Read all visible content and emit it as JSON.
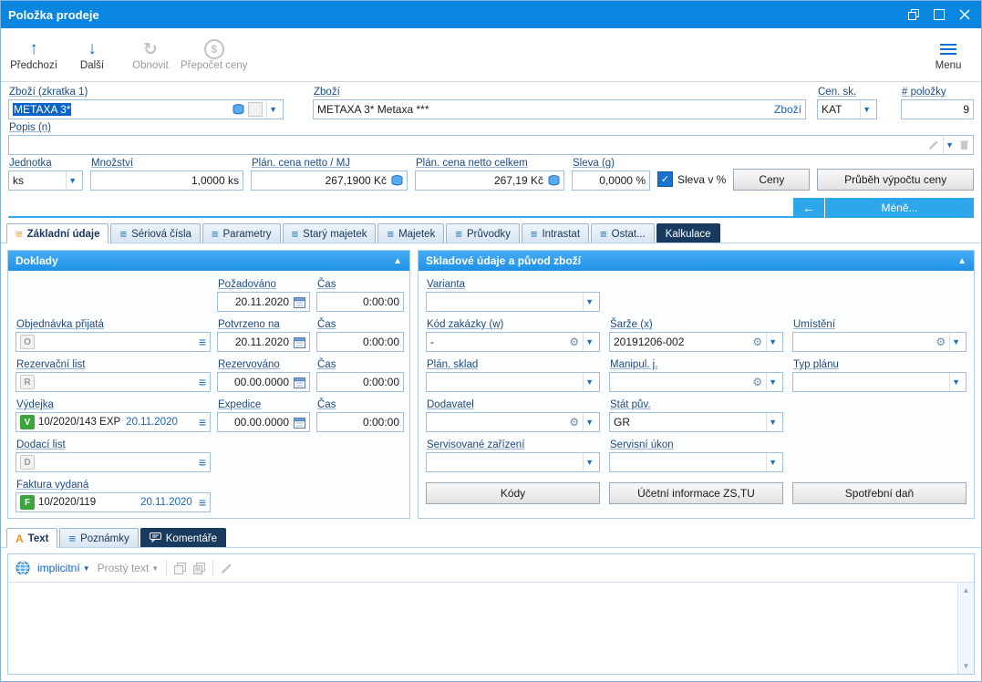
{
  "window": {
    "title": "Položka prodeje"
  },
  "colors": {
    "titlebar_blue": "#0a86e0",
    "panel_header_blue": "#2a9bec",
    "accent_blue": "#1d6fbd",
    "selection_blue": "#0a64c8",
    "dark_tab_navy": "#173a5e",
    "document_green": "#3aa53a",
    "less_button_blue": "#2da7ea"
  },
  "toolbar": {
    "previous": "Předchozí",
    "next": "Další",
    "refresh": "Obnovit",
    "recalculate": "Přepočet ceny",
    "menu": "Menu"
  },
  "item_header": {
    "code_label": "Zboží (zkratka 1)",
    "code_value": "METAXA 3*",
    "goods_label": "Zboží",
    "goods_value": "METAXA 3* Metaxa ***",
    "goods_link": "Zboží",
    "price_group_label": "Cen. sk.",
    "price_group_value": "KAT",
    "item_count_label": "# položky",
    "item_count_value": "9",
    "description_label": "Popis (n)",
    "unit_label": "Jednotka",
    "unit_value": "ks",
    "quantity_label": "Množství",
    "quantity_value": "1,0000 ks",
    "unit_price_label": "Plán. cena netto / MJ",
    "unit_price_value": "267,1900 Kč",
    "total_price_label": "Plán. cena netto celkem",
    "total_price_value": "267,19 Kč",
    "discount_label": "Sleva (g)",
    "discount_value": "0,0000 %",
    "discount_checkbox_label": "Sleva v %",
    "prices_button": "Ceny",
    "price_progress_button": "Průběh výpočtu ceny",
    "less_button": "Méně...",
    "less_arrow": "←"
  },
  "tabs": [
    {
      "label": "Základní údaje"
    },
    {
      "label": "Sériová čísla"
    },
    {
      "label": "Parametry"
    },
    {
      "label": "Starý majetek"
    },
    {
      "label": "Majetek"
    },
    {
      "label": "Průvodky"
    },
    {
      "label": "Intrastat"
    },
    {
      "label": "Ostat..."
    },
    {
      "label": "Kalkulace"
    }
  ],
  "documents_panel": {
    "title": "Doklady",
    "time_label": "Čas",
    "requested_label": "Požadováno",
    "requested_date": "20.11.2020",
    "requested_time": "0:00:00",
    "order_label": "Objednávka přijatá",
    "order_prefix": "O",
    "confirmed_label": "Potvrzeno na",
    "confirmed_date": "20.11.2020",
    "confirmed_time": "0:00:00",
    "reservation_label": "Rezervační list",
    "reservation_prefix": "R",
    "reserved_label": "Rezervováno",
    "reserved_date": "00.00.0000",
    "reserved_time": "0:00:00",
    "issue_label": "Výdejka",
    "issue_prefix": "V",
    "issue_number": "10/2020/143 EXP",
    "issue_date": "20.11.2020",
    "expedition_label": "Expedice",
    "expedition_date": "00.00.0000",
    "expedition_time": "0:00:00",
    "delivery_note_label": "Dodací list",
    "delivery_note_prefix": "D",
    "invoice_label": "Faktura vydaná",
    "invoice_prefix": "F",
    "invoice_number": "10/2020/119",
    "invoice_date": "20.11.2020"
  },
  "stock_panel": {
    "title": "Skladové údaje a původ zboží",
    "variant_label": "Varianta",
    "order_code_label": "Kód zakázky (w)",
    "order_code_value": "-",
    "batch_label": "Šarže (x)",
    "batch_value": "20191206-002",
    "location_label": "Umístění",
    "plan_warehouse_label": "Plán. sklad",
    "handling_unit_label": "Manipul. j.",
    "plan_type_label": "Typ plánu",
    "supplier_label": "Dodavatel",
    "origin_country_label": "Stát pův.",
    "origin_country_value": "GR",
    "serviced_device_label": "Servisované zařízení",
    "service_task_label": "Servisní úkon",
    "codes_button": "Kódy",
    "accounting_button": "Účetní informace ZS,TU",
    "excise_button": "Spotřební daň"
  },
  "text_tabs": [
    {
      "label": "Text"
    },
    {
      "label": "Poznámky"
    },
    {
      "label": "Komentáře"
    }
  ],
  "text_toolbar": {
    "language": "implicitní",
    "format": "Prostý text"
  }
}
